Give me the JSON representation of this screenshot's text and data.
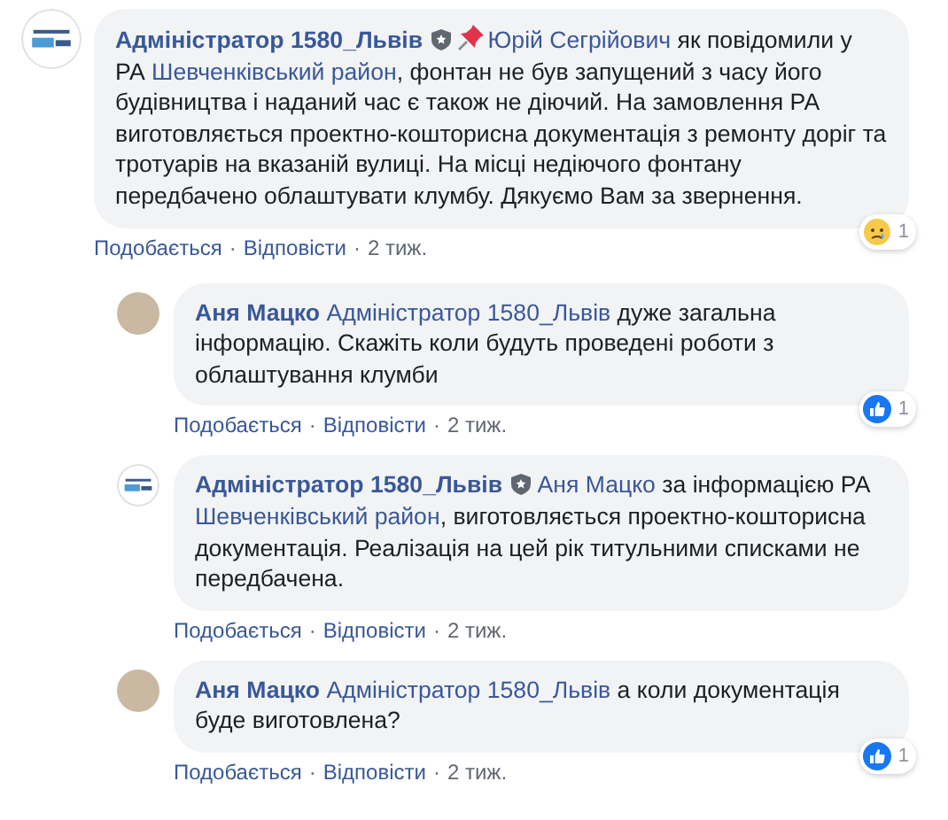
{
  "comments": [
    {
      "kind": "page",
      "author": "Адміністратор 1580_Львів",
      "verified": true,
      "body": [
        {
          "kind": "pin"
        },
        {
          "kind": "mention",
          "text": "Юрій Сегрійович"
        },
        {
          "kind": "text",
          "text": " як повідомили у РА "
        },
        {
          "kind": "mention",
          "text": "Шевченківський район"
        },
        {
          "kind": "text",
          "text": ", фонтан не був запущений з часу його будівництва і наданий час є також не діючий. На замовлення РА виготовляється проектно-кошторисна документація з ремонту доріг та тротуарів на вказаній вулиці. На місці недіючого фонтану передбачено облаштувати клумбу. Дякуємо Вам за звернення."
        }
      ],
      "reaction": {
        "kind": "sad",
        "count": "1"
      },
      "footer": [
        {
          "kind": "link",
          "text": "Подобається"
        },
        {
          "kind": "sep",
          "text": "·"
        },
        {
          "kind": "link",
          "text": "Відповісти"
        },
        {
          "kind": "sep",
          "text": "·"
        },
        {
          "kind": "time",
          "text": "2 тиж."
        }
      ],
      "children": [
        {
          "kind": "person",
          "author": "Аня Мацко",
          "verified": false,
          "body": [
            {
              "kind": "mention",
              "text": "Адміністратор 1580_Львів"
            },
            {
              "kind": "text",
              "text": " дуже загальна інформацію. Скажіть коли будуть проведені роботи з облаштування клумби"
            }
          ],
          "reaction": {
            "kind": "like",
            "count": "1"
          },
          "footer": [
            {
              "kind": "link",
              "text": "Подобається"
            },
            {
              "kind": "sep",
              "text": "·"
            },
            {
              "kind": "link",
              "text": "Відповісти"
            },
            {
              "kind": "sep",
              "text": "·"
            },
            {
              "kind": "time",
              "text": "2 тиж."
            }
          ]
        },
        {
          "kind": "page",
          "author": "Адміністратор 1580_Львів",
          "verified": true,
          "body": [
            {
              "kind": "mention",
              "text": "Аня Мацко"
            },
            {
              "kind": "text",
              "text": " за інформацією РА "
            },
            {
              "kind": "mention",
              "text": "Шевченківський район"
            },
            {
              "kind": "text",
              "text": ", виготовляється проектно-кошторисна документація. Реалізація на цей рік титульними списками не передбачена."
            }
          ],
          "footer": [
            {
              "kind": "link",
              "text": "Подобається"
            },
            {
              "kind": "sep",
              "text": "·"
            },
            {
              "kind": "link",
              "text": "Відповісти"
            },
            {
              "kind": "sep",
              "text": "·"
            },
            {
              "kind": "time",
              "text": "2 тиж."
            }
          ]
        },
        {
          "kind": "person",
          "author": "Аня Мацко",
          "verified": false,
          "body": [
            {
              "kind": "mention",
              "text": "Адміністратор 1580_Львів"
            },
            {
              "kind": "text",
              "text": " а коли документація буде виготовлена?"
            }
          ],
          "reaction": {
            "kind": "like",
            "count": "1"
          },
          "footer": [
            {
              "kind": "link",
              "text": "Подобається"
            },
            {
              "kind": "sep",
              "text": "·"
            },
            {
              "kind": "link",
              "text": "Відповісти"
            },
            {
              "kind": "sep",
              "text": "·"
            },
            {
              "kind": "time",
              "text": "2 тиж."
            }
          ]
        }
      ]
    }
  ]
}
